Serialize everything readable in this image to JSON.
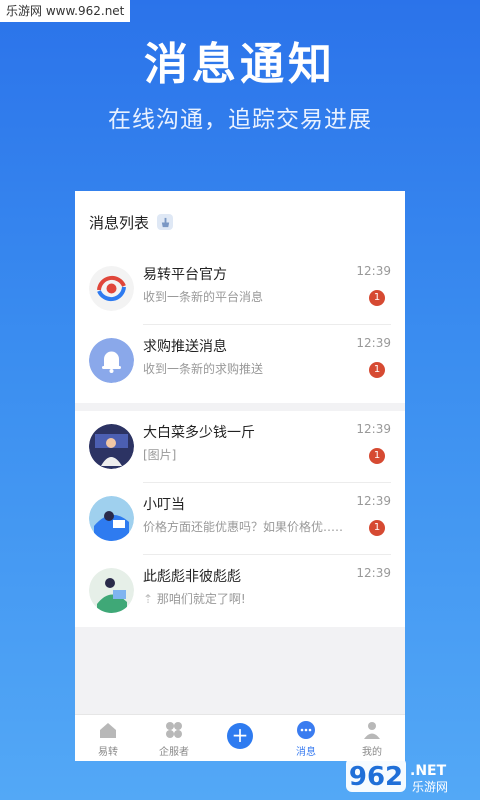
{
  "watermark": {
    "site": "乐游网 www.962.net",
    "logo_text": "962",
    "logo_suffix": ".NET",
    "logo_sub": "乐游网"
  },
  "promo": {
    "title": "消息通知",
    "subtitle": "在线沟通，追踪交易进展"
  },
  "list": {
    "title": "消息列表",
    "clean_icon": "broom-icon",
    "system_items": [
      {
        "name": "易转平台官方",
        "preview": "收到一条新的平台消息",
        "time": "12:39",
        "badge": "1"
      },
      {
        "name": "求购推送消息",
        "preview": "收到一条新的求购推送",
        "time": "12:39",
        "badge": "1"
      }
    ],
    "chat_items": [
      {
        "name": "大白菜多少钱一斤",
        "preview": "[图片]",
        "time": "12:39",
        "badge": "1"
      },
      {
        "name": "小叮当",
        "preview": "价格方面还能优惠吗？如果价格优……",
        "time": "12:39",
        "badge": "1"
      },
      {
        "name": "此彪彪非彼彪彪",
        "preview": "那咱们就定了啊!",
        "time": "12:39",
        "badge": ""
      }
    ]
  },
  "tabbar": {
    "tabs": [
      {
        "label": "易转",
        "icon": "home-icon"
      },
      {
        "label": "企服者",
        "icon": "grid-icon"
      },
      {
        "label": "",
        "icon": "plus-icon"
      },
      {
        "label": "消息",
        "icon": "chat-icon"
      },
      {
        "label": "我的",
        "icon": "user-icon"
      }
    ]
  },
  "colors": {
    "accent": "#2e7bf0",
    "badge": "#d64a32"
  }
}
